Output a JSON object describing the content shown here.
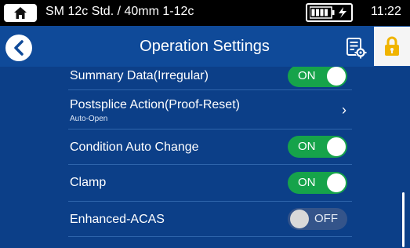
{
  "status": {
    "title": "SM 12c Std. / 40mm 1-12c",
    "time": "11:22",
    "icons": [
      "home-icon",
      "battery-icon",
      "charging-icon"
    ]
  },
  "header": {
    "title": "Operation Settings",
    "icons": [
      "back-icon",
      "settings-list-icon",
      "lock-icon"
    ]
  },
  "settings": [
    {
      "label": "Summary Data(Irregular)",
      "state": "ON"
    },
    {
      "label": "Postsplice Action(Proof-Reset)",
      "sub": "Auto-Open",
      "chevron": "›"
    },
    {
      "label": "Condition Auto Change",
      "state": "ON"
    },
    {
      "label": "Clamp",
      "state": "ON"
    },
    {
      "label": "Enhanced-ACAS",
      "state": "OFF"
    }
  ],
  "colors": {
    "header_bg": "#0f4a99",
    "list_bg": "#0c3f88",
    "toggle_on": "#16a34a",
    "lock_accent": "#f0b400"
  }
}
